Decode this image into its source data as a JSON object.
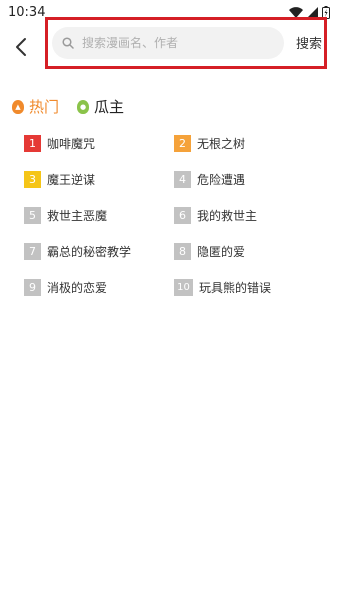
{
  "status": {
    "time": "10:34"
  },
  "search": {
    "placeholder": "搜索漫画名、作者",
    "submit_label": "搜索"
  },
  "tabs": [
    {
      "label": "热门",
      "icon": "fire-icon",
      "active": true,
      "color": "#f08a2c"
    },
    {
      "label": "瓜主",
      "icon": "melon-icon",
      "active": false,
      "color": "#8bc34a"
    }
  ],
  "rank_colors": {
    "first": "#e53935",
    "second": "#f5a23a",
    "third": "#f5c518",
    "rest": "#c2c2c2"
  },
  "rankings": [
    {
      "rank": "1",
      "title": "咖啡魔咒"
    },
    {
      "rank": "2",
      "title": "无根之树"
    },
    {
      "rank": "3",
      "title": "魔王逆谋"
    },
    {
      "rank": "4",
      "title": "危险遭遇"
    },
    {
      "rank": "5",
      "title": "救世主恶魔"
    },
    {
      "rank": "6",
      "title": "我的救世主"
    },
    {
      "rank": "7",
      "title": "霸总的秘密教学"
    },
    {
      "rank": "8",
      "title": "隐匿的爱"
    },
    {
      "rank": "9",
      "title": "消极的恋爱"
    },
    {
      "rank": "10",
      "title": "玩具熊的错误"
    }
  ]
}
